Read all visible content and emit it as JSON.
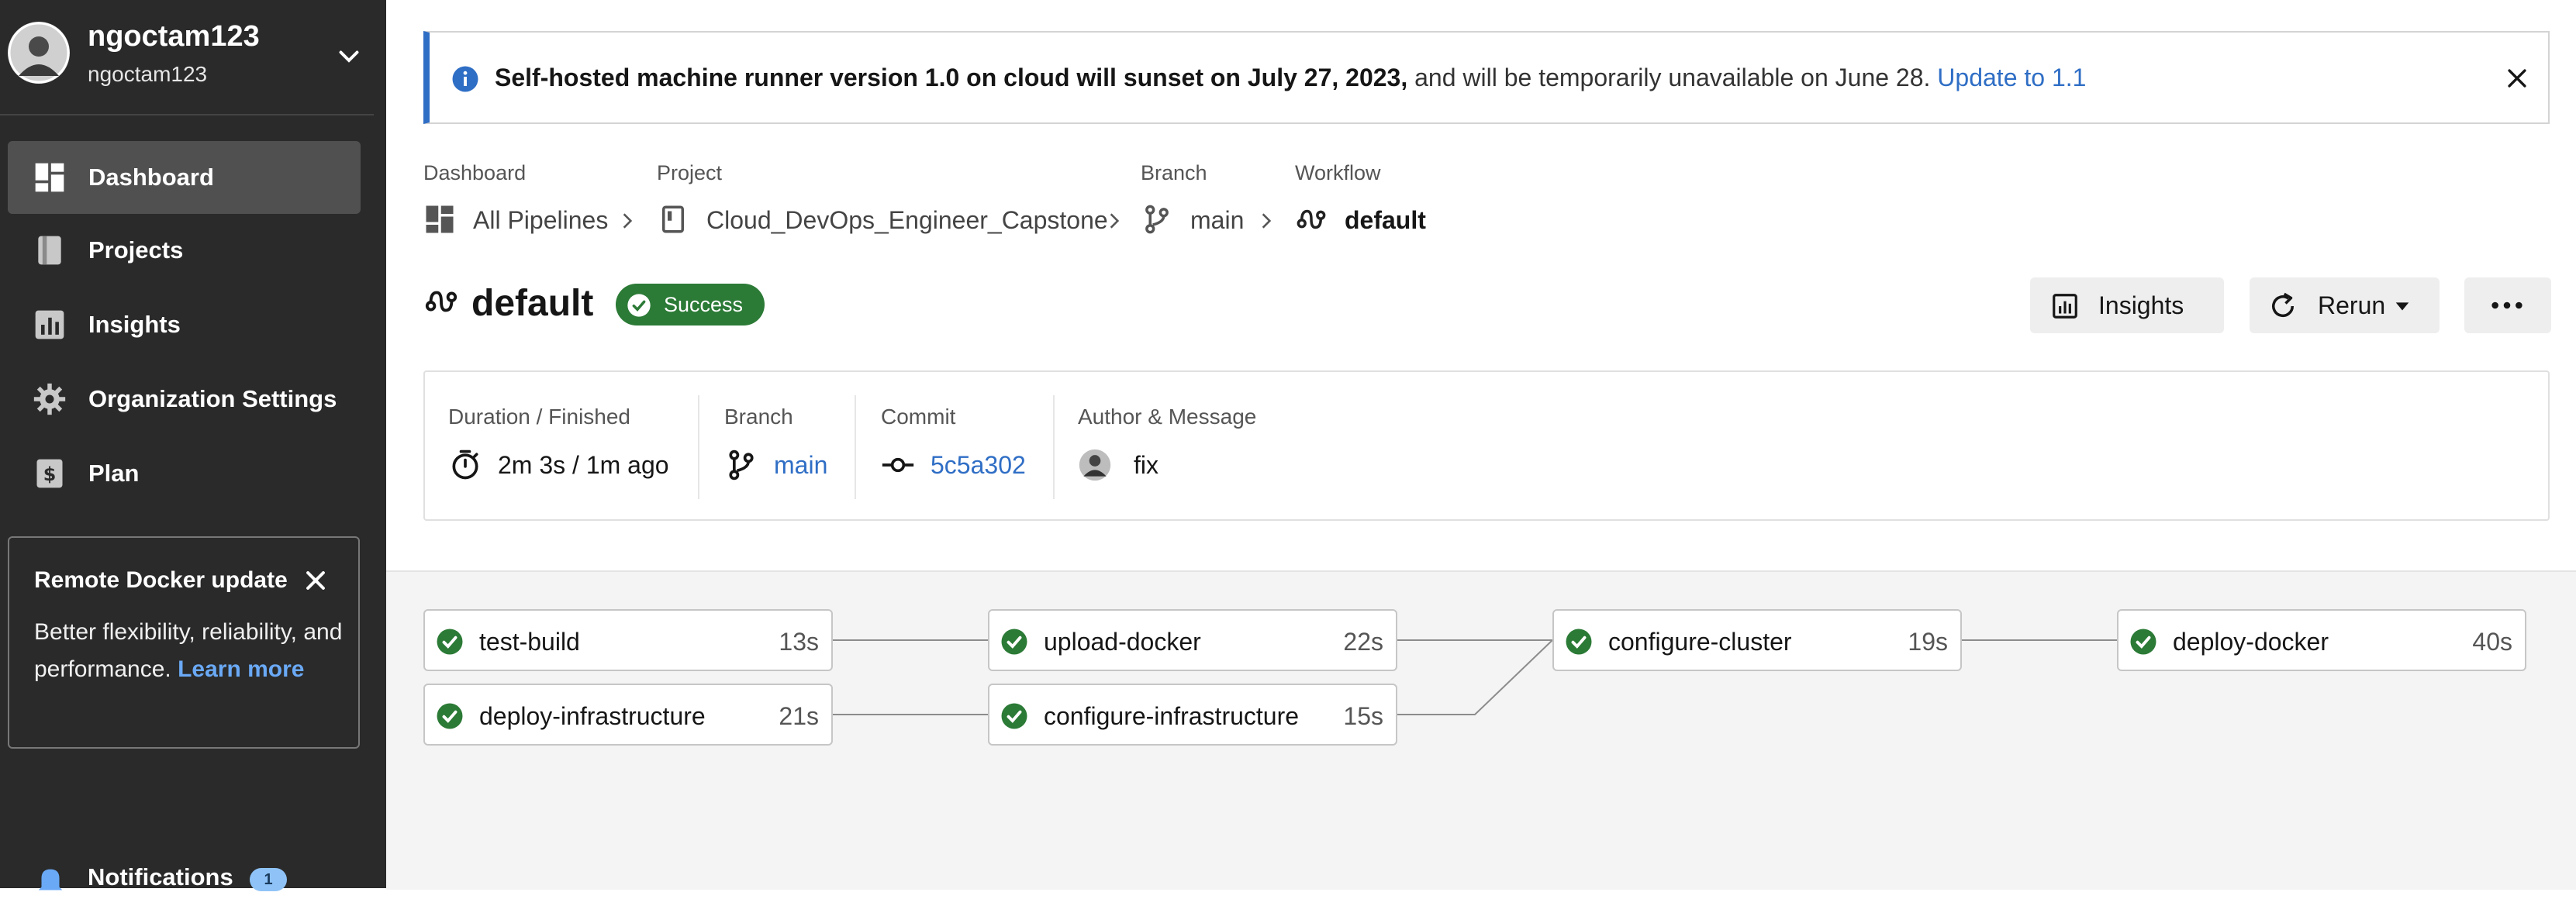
{
  "sidebar": {
    "user": {
      "name": "ngoctam123",
      "org": "ngoctam123"
    },
    "items": [
      {
        "label": "Dashboard",
        "icon": "dashboard-icon",
        "active": true
      },
      {
        "label": "Projects",
        "icon": "projects-icon",
        "active": false
      },
      {
        "label": "Insights",
        "icon": "insights-icon",
        "active": false
      },
      {
        "label": "Organization Settings",
        "icon": "gear-icon",
        "active": false
      },
      {
        "label": "Plan",
        "icon": "dollar-icon",
        "active": false
      }
    ],
    "docker_card": {
      "title": "Remote Docker update",
      "body": "Better flexibility, reliability, and performance.",
      "link": "Learn more"
    },
    "notifications": {
      "label": "Notifications",
      "count": "1"
    }
  },
  "banner": {
    "bold": "Self-hosted machine runner version 1.0 on cloud will sunset on July 27, 2023,",
    "normal": " and will be temporarily unavailable on June 28. ",
    "link": "Update to 1.1"
  },
  "breadcrumb": {
    "dashboard": {
      "head": "Dashboard",
      "value": "All Pipelines"
    },
    "project": {
      "head": "Project",
      "value": "Cloud_DevOps_Engineer_Capstone"
    },
    "branch": {
      "head": "Branch",
      "value": "main"
    },
    "workflow": {
      "head": "Workflow",
      "value": "default"
    }
  },
  "header": {
    "title": "default",
    "status": "Success",
    "insights_label": "Insights",
    "rerun_label": "Rerun"
  },
  "summary": {
    "duration": {
      "head": "Duration / Finished",
      "value": "2m 3s / 1m ago"
    },
    "branch": {
      "head": "Branch",
      "value": "main"
    },
    "commit": {
      "head": "Commit",
      "value": "5c5a302"
    },
    "author": {
      "head": "Author & Message",
      "value": "fix"
    }
  },
  "jobs": [
    {
      "name": "test-build",
      "duration": "13s",
      "status": "success"
    },
    {
      "name": "deploy-infrastructure",
      "duration": "21s",
      "status": "success"
    },
    {
      "name": "upload-docker",
      "duration": "22s",
      "status": "success"
    },
    {
      "name": "configure-infrastructure",
      "duration": "15s",
      "status": "success"
    },
    {
      "name": "configure-cluster",
      "duration": "19s",
      "status": "success"
    },
    {
      "name": "deploy-docker",
      "duration": "40s",
      "status": "success"
    }
  ],
  "colors": {
    "sidebar_bg": "#2a2a2a",
    "accent_blue": "#2f6ec5",
    "success_green": "#2b7a36"
  }
}
